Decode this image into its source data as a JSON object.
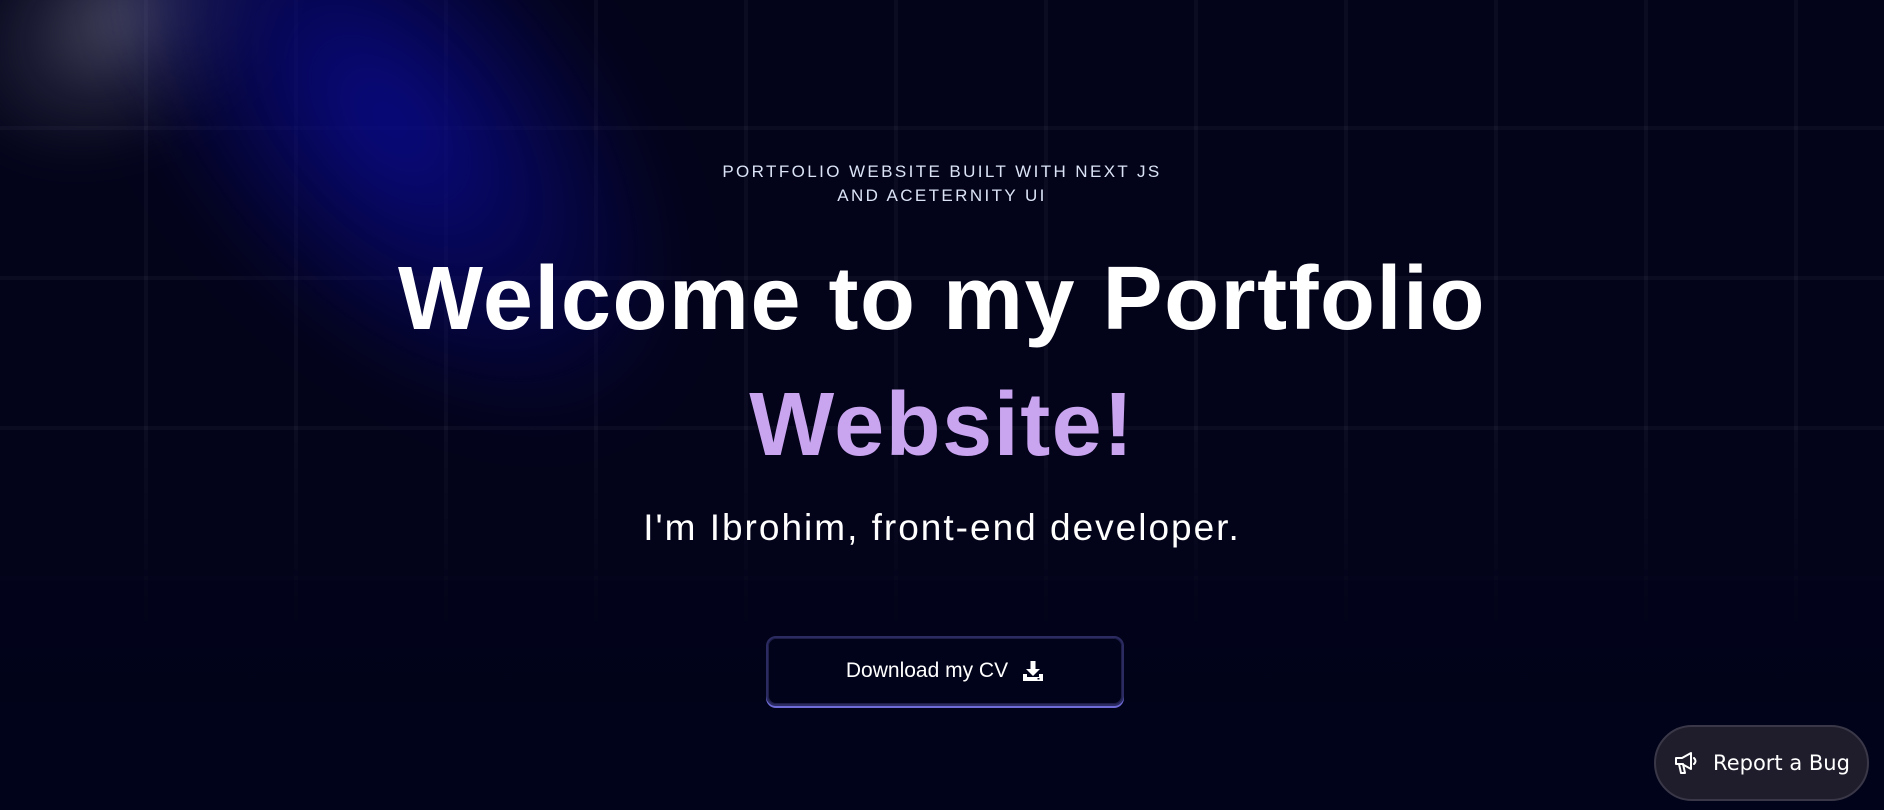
{
  "hero": {
    "tagline_line1": "PORTFOLIO WEBSITE BUILT WITH NEXT JS",
    "tagline_line2": "AND ACETERNITY UI",
    "headline_main": "Welcome to my Portfolio",
    "headline_accent": "Website!",
    "subline": "I'm Ibrohim, front-end developer."
  },
  "cv_button": {
    "label": "Download my CV",
    "icon": "download-icon"
  },
  "bug_button": {
    "label": "Report a Bug",
    "icon": "megaphone-icon"
  },
  "colors": {
    "background": "#000319",
    "accent": "#c9a4ef",
    "text": "#ffffff",
    "button_border": "#6f6cd8"
  }
}
